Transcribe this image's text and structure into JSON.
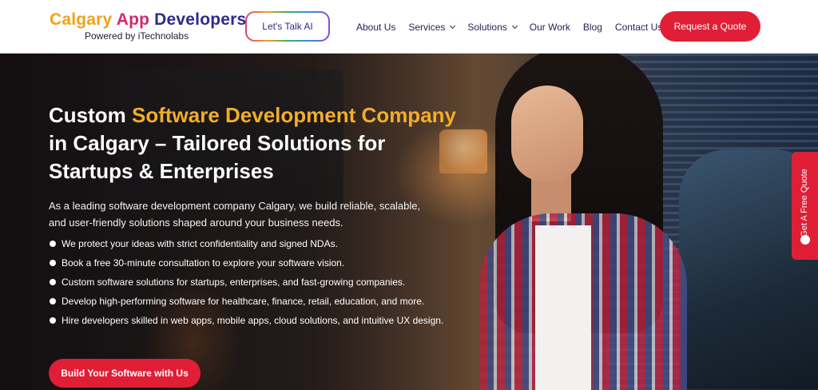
{
  "header": {
    "logo": {
      "brand_part1": "Calgary ",
      "brand_part2": "App",
      "brand_part3": " Developers",
      "tagline": "Powered by iTechnolabs"
    },
    "talk_button_label": "Let's Talk AI",
    "nav": {
      "items": [
        {
          "label": "About Us",
          "has_dropdown": false
        },
        {
          "label": "Services",
          "has_dropdown": true
        },
        {
          "label": "Solutions",
          "has_dropdown": true
        },
        {
          "label": "Our Work",
          "has_dropdown": false
        },
        {
          "label": "Blog",
          "has_dropdown": false
        },
        {
          "label": "Contact Us",
          "has_dropdown": false
        }
      ]
    },
    "quote_button_label": "Request a Quote"
  },
  "hero": {
    "title_part1": "Custom ",
    "title_highlight1": "Software Development",
    "title_part2": " ",
    "title_highlight2": "Company",
    "title_part3": " in Calgary – Tailored Solutions for Startups & Enterprises",
    "description": "As a leading software development company Calgary, we build reliable, scalable, and user-friendly solutions shaped around your business needs.",
    "bullets": [
      "We protect your ideas with strict confidentiality and signed NDAs.",
      "Book a free 30-minute consultation to explore your software vision.",
      "Custom software solutions for startups, enterprises, and fast-growing companies.",
      "Develop high-performing software for healthcare, finance, retail, education, and more.",
      "Hire developers skilled in web apps, mobile apps, cloud solutions, and intuitive UX design."
    ],
    "cta_label": "Build Your Software with Us"
  },
  "side_tab": {
    "label": "Get A Free Quote",
    "icon": "chat-bubble-icon"
  },
  "colors": {
    "brand_navy": "#2f2b8a",
    "brand_orange": "#f2a21a",
    "accent_red": "#e01f36",
    "headline_highlight": "#f3ad2a"
  }
}
